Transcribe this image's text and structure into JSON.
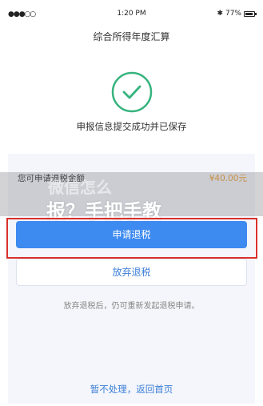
{
  "status_bar": {
    "signal": "●●●○○",
    "time": "1:20 PM",
    "bluetooth": "✱",
    "battery_percent": "77%"
  },
  "header": {
    "title": "综合所得年度汇算"
  },
  "success": {
    "message": "申报信息提交成功并已保存"
  },
  "refund": {
    "label": "您可申请退税金额",
    "amount": "¥40.00元"
  },
  "actions": {
    "apply_label": "申请退税",
    "giveup_label": "放弃退税",
    "note": "放弃退税后，仍可重新发起退税申请。",
    "back_label": "暂不处理，返回首页"
  },
  "overlay": {
    "line1": "微信怎么",
    "line2": "报？手把手教"
  },
  "colors": {
    "primary": "#3d8af0",
    "success_green": "#36b37e",
    "amount_orange": "#f0a030",
    "highlight_red": "#d9302c"
  },
  "icons": {
    "success": "check-circle-icon",
    "battery": "battery-icon",
    "bluetooth": "bluetooth-icon",
    "signal": "signal-icon"
  }
}
